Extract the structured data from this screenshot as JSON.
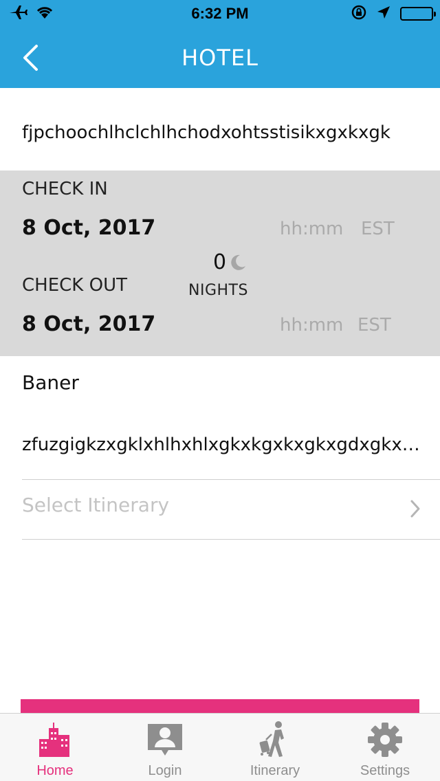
{
  "status_bar": {
    "time": "6:32 PM",
    "icons": [
      "airplane-icon",
      "wifi-icon",
      "rotation-lock-icon",
      "location-arrow-icon",
      "battery-icon"
    ]
  },
  "header": {
    "title": "HOTEL",
    "back_icon": "chevron-left-icon",
    "background_color": "#2aa3dc"
  },
  "hotel": {
    "name": "fjpchoochlhclchlhchodxohtsstisikxgxkxgk"
  },
  "stay": {
    "check_in_label": "CHECK IN",
    "check_in_date": "8 Oct, 2017",
    "check_in_time_placeholder": "hh:mm",
    "check_in_timezone": "EST",
    "check_out_label": "CHECK OUT",
    "check_out_date": "8 Oct, 2017",
    "check_out_time_placeholder": "hh:mm",
    "check_out_timezone": "EST",
    "nights_count": "0",
    "nights_label": "NIGHTS",
    "nights_icon": "moon-icon"
  },
  "address": {
    "line1": "Baner",
    "line2": "zfuzgigkzxgklxhlhxhlxgkxkgxkxgkxgdxgkxgkx"
  },
  "itinerary_select": {
    "placeholder": "Select Itinerary",
    "icon": "chevron-right-icon"
  },
  "accent_color": "#e5317d",
  "tab_bar": {
    "tabs": [
      {
        "label": "Home",
        "icon": "city-buildings-icon",
        "active": true
      },
      {
        "label": "Login",
        "icon": "user-badge-icon",
        "active": false
      },
      {
        "label": "Itinerary",
        "icon": "traveler-luggage-icon",
        "active": false
      },
      {
        "label": "Settings",
        "icon": "gear-icon",
        "active": false
      }
    ]
  }
}
